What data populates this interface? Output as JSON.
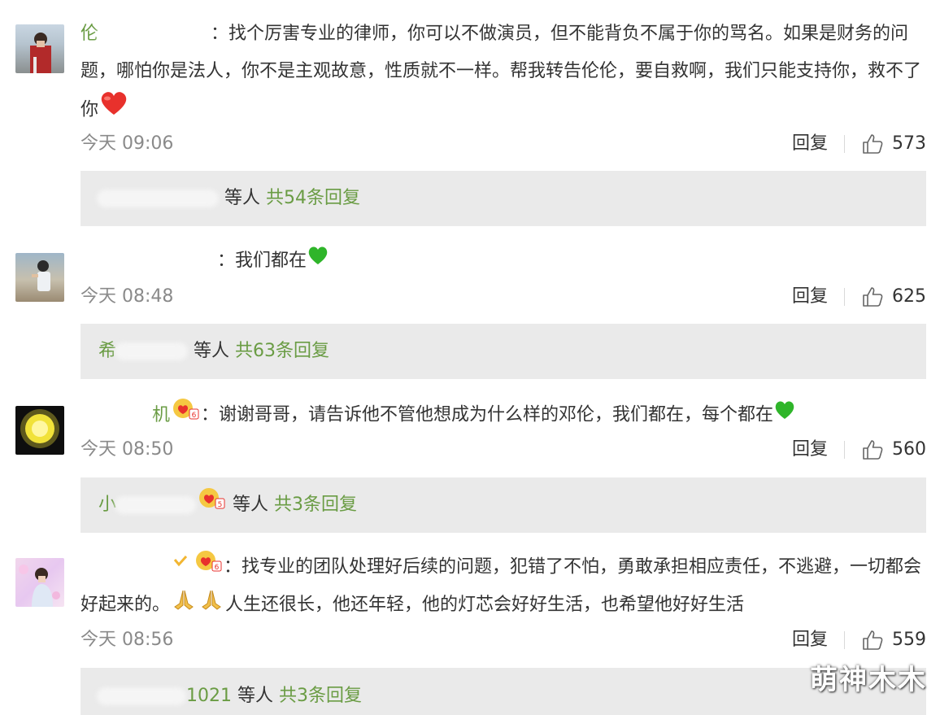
{
  "comments": [
    {
      "name": "伦",
      "text": "：找个厉害专业的律师，你可以不做演员，但不能背负不属于你的骂名。如果是财务的问题，哪怕你是法人，你不是主观故意，性质就不一样。帮我转告伦伦，要自救啊，我们只能支持你，救不了你",
      "trailing_emoji": "red-heart",
      "time": "今天 09:06",
      "reply_label": "回复",
      "likes": "573",
      "thread": {
        "who": "",
        "etc": "等人",
        "total": "共54条回复"
      }
    },
    {
      "name": "",
      "text": "：我们都在",
      "trailing_emoji": "green-heart",
      "time": "今天 08:48",
      "reply_label": "回复",
      "likes": "625",
      "thread": {
        "who": "希",
        "etc": "等人",
        "total": "共63条回复"
      }
    },
    {
      "name": "机",
      "text": "：谢谢哥哥，请告诉他不管他想成为什么样的邓伦，我们都在，每个都在",
      "trailing_emoji": "green-heart",
      "time": "今天 08:50",
      "reply_label": "回复",
      "likes": "560",
      "thread": {
        "who": "小",
        "etc": "等人",
        "total": "共3条回复"
      }
    },
    {
      "name": "",
      "text": "：找专业的团队处理好后续的问题，犯错了不怕，勇敢承担相应责任，不逃避，一切都会好起来的。",
      "text2": "人生还很长，他还年轻，他的灯芯会好好生活，也希望他好好生活",
      "time": "今天 08:56",
      "reply_label": "回复",
      "likes": "559",
      "thread": {
        "who": "1021",
        "etc": "等人",
        "total": "共3条回复"
      }
    }
  ],
  "watermark": "萌神木木",
  "colors": {
    "name_green": "#6a9c44",
    "reply_bg": "#eaeaea",
    "time_gray": "#8a8a8a"
  }
}
